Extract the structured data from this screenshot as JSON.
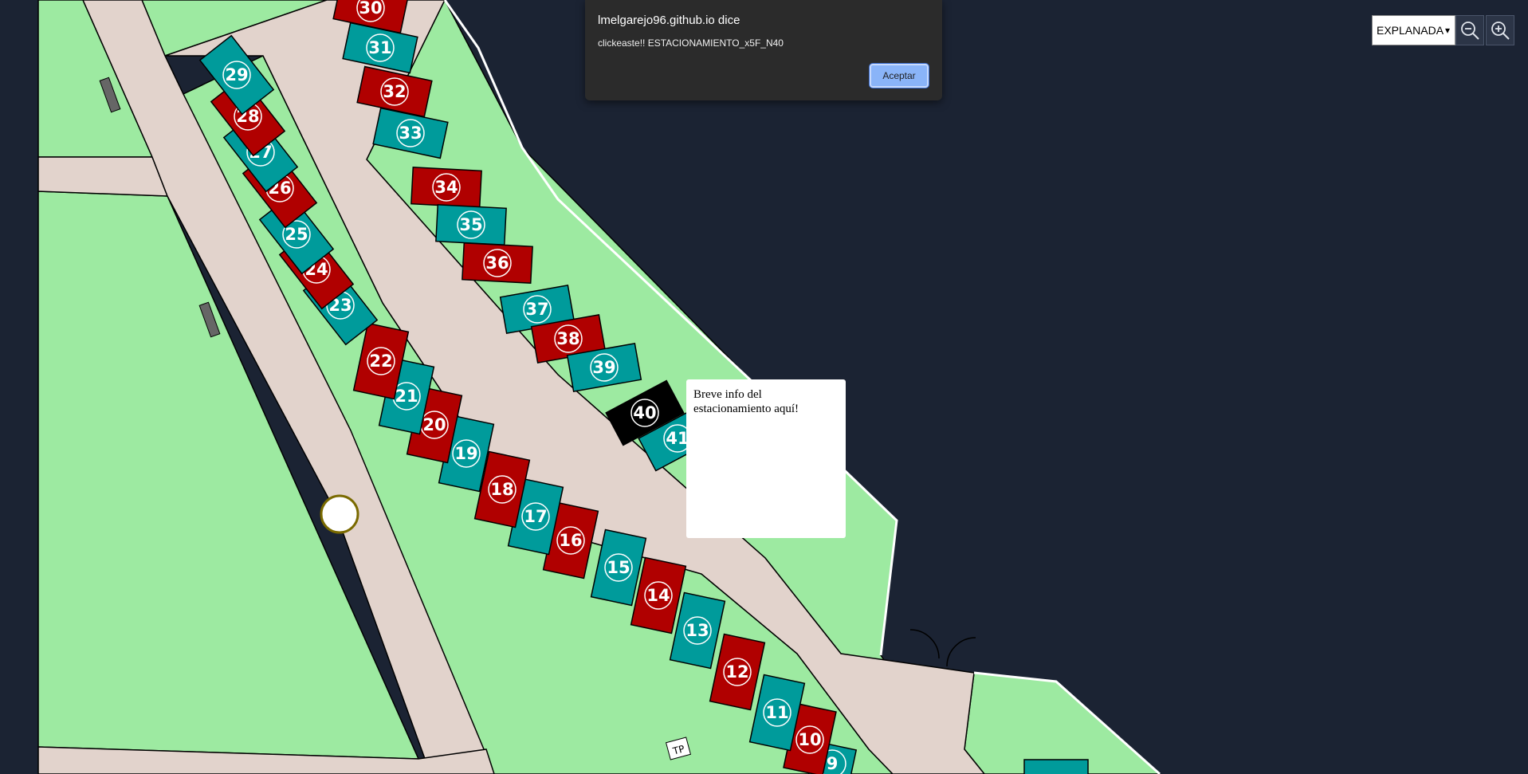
{
  "colors": {
    "background": "#1b2333",
    "grass": "#9deaa1",
    "pavement": "#e2d3cc",
    "stall_red": "#b00000",
    "stall_teal": "#009b9b",
    "stall_selected": "#000000"
  },
  "controls": {
    "zone_selected": "EXPLANADA",
    "chevron_icon": "chevron-down-icon",
    "zoom_out_icon": "zoom-out-icon",
    "zoom_in_icon": "zoom-in-icon"
  },
  "dialog": {
    "title": "lmelgarejo96.github.io dice",
    "message": "clickeaste!! ESTACIONAMIENTO_x5F_N40",
    "ok_label": "Aceptar"
  },
  "info_popup": {
    "text": "Breve info del estacionamiento aquí!"
  },
  "map": {
    "selected_stall": "40",
    "stalls": [
      {
        "n": "9",
        "color": "teal"
      },
      {
        "n": "10",
        "color": "red"
      },
      {
        "n": "11",
        "color": "teal"
      },
      {
        "n": "12",
        "color": "red"
      },
      {
        "n": "13",
        "color": "teal"
      },
      {
        "n": "14",
        "color": "red"
      },
      {
        "n": "15",
        "color": "teal"
      },
      {
        "n": "16",
        "color": "red"
      },
      {
        "n": "17",
        "color": "teal"
      },
      {
        "n": "18",
        "color": "red"
      },
      {
        "n": "19",
        "color": "teal"
      },
      {
        "n": "20",
        "color": "red"
      },
      {
        "n": "21",
        "color": "teal"
      },
      {
        "n": "22",
        "color": "red"
      },
      {
        "n": "23",
        "color": "teal"
      },
      {
        "n": "24",
        "color": "red"
      },
      {
        "n": "25",
        "color": "teal"
      },
      {
        "n": "26",
        "color": "red"
      },
      {
        "n": "27",
        "color": "teal"
      },
      {
        "n": "28",
        "color": "red"
      },
      {
        "n": "29",
        "color": "teal"
      },
      {
        "n": "30",
        "color": "red"
      },
      {
        "n": "31",
        "color": "teal"
      },
      {
        "n": "32",
        "color": "red"
      },
      {
        "n": "33",
        "color": "teal"
      },
      {
        "n": "34",
        "color": "red"
      },
      {
        "n": "35",
        "color": "teal"
      },
      {
        "n": "36",
        "color": "red"
      },
      {
        "n": "37",
        "color": "teal"
      },
      {
        "n": "38",
        "color": "red"
      },
      {
        "n": "39",
        "color": "teal"
      },
      {
        "n": "40",
        "color": "selected"
      },
      {
        "n": "41",
        "color": "teal"
      },
      {
        "n": "",
        "color": "red"
      },
      {
        "n": "",
        "color": "teal"
      }
    ]
  }
}
